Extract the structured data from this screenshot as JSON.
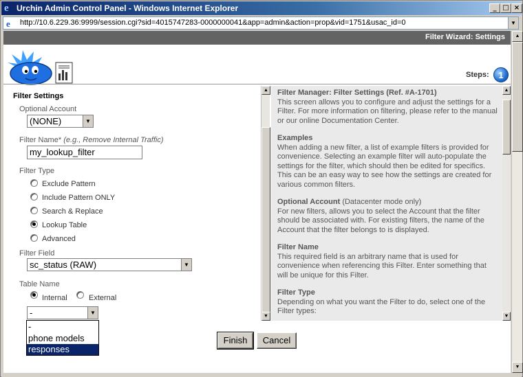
{
  "window": {
    "title": "Urchin Admin Control Panel - Windows Internet Explorer",
    "min_glyph": "_",
    "max_glyph": "□",
    "close_glyph": "×"
  },
  "address": {
    "url": "http://10.6.229.36:9999/session.cgi?sid=4015747283-0000000041&app=admin&action=prop&vid=1751&usac_id=0"
  },
  "header": {
    "wizard_title": "Filter Wizard: Settings",
    "steps_label": "Steps:",
    "step_number": "1"
  },
  "form": {
    "section_title": "Filter Settings",
    "optional_account": {
      "label": "Optional Account",
      "value": "(NONE)"
    },
    "filter_name": {
      "label": "Filter Name*",
      "hint": "(e.g., Remove Internal Traffic)",
      "value": "my_lookup_filter"
    },
    "filter_type": {
      "label": "Filter Type",
      "options": [
        {
          "label": "Exclude Pattern",
          "checked": false
        },
        {
          "label": "Include Pattern ONLY",
          "checked": false
        },
        {
          "label": "Search & Replace",
          "checked": false
        },
        {
          "label": "Lookup Table",
          "checked": true
        },
        {
          "label": "Advanced",
          "checked": false
        }
      ]
    },
    "filter_field": {
      "label": "Filter Field",
      "value": "sc_status (RAW)"
    },
    "table_name": {
      "label": "Table Name",
      "internal_label": "Internal",
      "external_label": "External",
      "selected": "Internal",
      "dropdown_value": "-",
      "dropdown_options": [
        "-",
        "phone models",
        "responses"
      ],
      "highlighted_option": "responses"
    }
  },
  "help": {
    "sections": [
      {
        "title": "Filter Manager: Filter Settings (Ref. #A-1701)",
        "title_note": "",
        "body": "This screen allows you to configure and adjust the settings for a Filter. For more information on filtering, please refer to the manual or our online Documentation Center."
      },
      {
        "title": "Examples",
        "title_note": "",
        "body": "When adding a new filter, a list of example filters is provided for convenience. Selecting an example filter will auto-populate the settings for the filter, which should then be edited for specifics. This can be an easy way to see how the settings are created for various common filters."
      },
      {
        "title": "Optional Account",
        "title_note": "(Datacenter mode only)",
        "body": "For new filters, allows you to select the Account that the filter should be associated with. For existing filters, the name of the Account that the filter belongs to is displayed."
      },
      {
        "title": "Filter Name",
        "title_note": "",
        "body": "This required field is an arbitrary name that is used for convenience when referencing this Filter. Enter something that will be unique for this Filter."
      },
      {
        "title": "Filter Type",
        "title_note": "",
        "body": "Depending on what you want the Filter to do, select one of the Filter types:"
      }
    ]
  },
  "buttons": {
    "finish": "Finish",
    "cancel": "Cancel"
  },
  "icons": {
    "ie_icon": "ie-logo-icon",
    "arrow_glyph": "▼",
    "up_glyph": "▲"
  }
}
